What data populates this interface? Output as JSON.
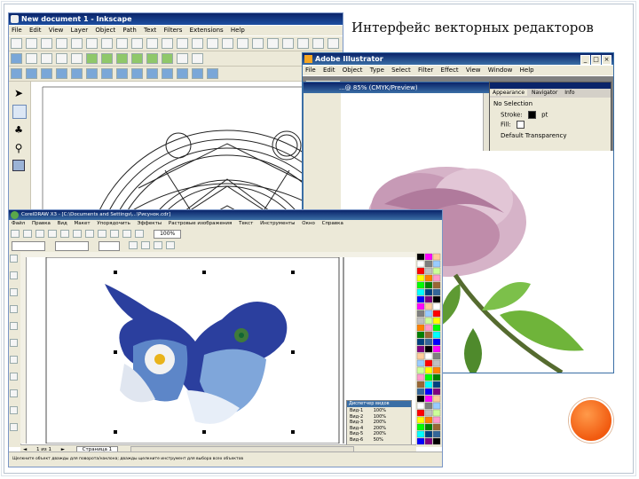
{
  "slide": {
    "title": "Интерфейс векторных редакторов"
  },
  "inkscape": {
    "title": "New document 1 - Inkscape",
    "menu": [
      "File",
      "Edit",
      "View",
      "Layer",
      "Object",
      "Path",
      "Text",
      "Filters",
      "Extensions",
      "Help"
    ]
  },
  "illustrator": {
    "title": "Adobe Illustrator",
    "menu": [
      "File",
      "Edit",
      "Object",
      "Type",
      "Select",
      "Filter",
      "Effect",
      "View",
      "Window",
      "Help"
    ],
    "doc_tab": "...@ 85% (CMYK/Preview)",
    "panel": {
      "tabs": [
        "Appearance",
        "Navigator",
        "Info"
      ],
      "selection": "No Selection",
      "stroke_label": "Stroke:",
      "stroke_value": "pt",
      "fill_label": "Fill:",
      "transparency": "Default Transparency"
    }
  },
  "corel": {
    "title": "CorelDRAW X3 - [C:\\Documents and Settings\\...\\Рисунок.cdr]",
    "menu": [
      "Файл",
      "Правка",
      "Вид",
      "Макет",
      "Упорядочить",
      "Эффекты",
      "Растровые изображения",
      "Текст",
      "Инструменты",
      "Окно",
      "Справка"
    ],
    "zoom": "100%",
    "page_tab": "Страница 1",
    "page_counter": "1 из 1",
    "status_left": "Щелкните объект дважды для поворота/наклона; дважды щелкните инструмент для выбора всех объектов",
    "docker_title": "Диспетчер видов",
    "docker_rows": [
      "Вид-1",
      "Вид-2",
      "Вид-3",
      "Вид-4",
      "Вид-5",
      "Вид-6"
    ],
    "docker_zoom": [
      "100%",
      "100%",
      "200%",
      "200%",
      "200%",
      "50%"
    ]
  },
  "colors": {
    "titlebar": "#0a246a",
    "chrome": "#ece9d8",
    "accent_orange": "#f15a0f"
  }
}
